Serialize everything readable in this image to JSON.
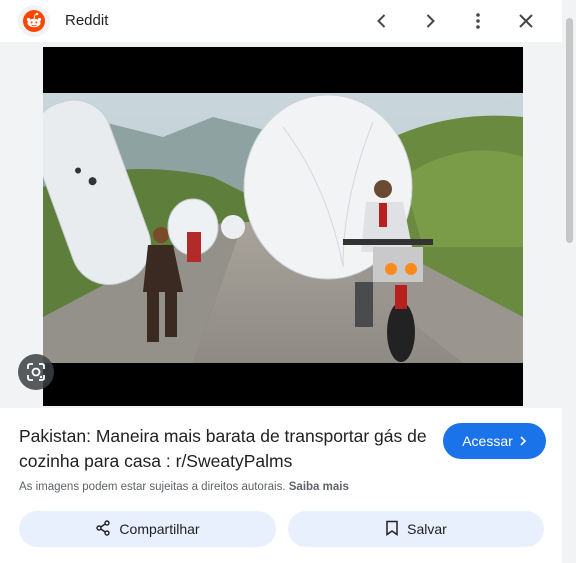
{
  "header": {
    "site_name": "Reddit",
    "logo_icon": "reddit-alien-icon",
    "brand_color": "#ff4500",
    "nav": {
      "prev_icon": "chevron-left-icon",
      "next_icon": "chevron-right-icon",
      "more_icon": "more-vert-icon",
      "close_icon": "close-icon"
    }
  },
  "image": {
    "lens_icon": "google-lens-icon"
  },
  "result": {
    "title": "Pakistan: Maneira mais barata de transportar gás de cozinha para casa : r/SweatyPalms",
    "visit_label": "Acessar",
    "visit_icon": "chevron-right-icon",
    "copyright_text": "As imagens podem estar sujeitas a direitos autorais.",
    "learn_more": "Saiba mais"
  },
  "actions": {
    "share_label": "Compartilhar",
    "share_icon": "share-icon",
    "save_label": "Salvar",
    "save_icon": "bookmark-icon"
  },
  "colors": {
    "accent": "#1a73e8",
    "pill_bg": "#e8f0fe",
    "panel_bg": "#f1f3f4"
  }
}
